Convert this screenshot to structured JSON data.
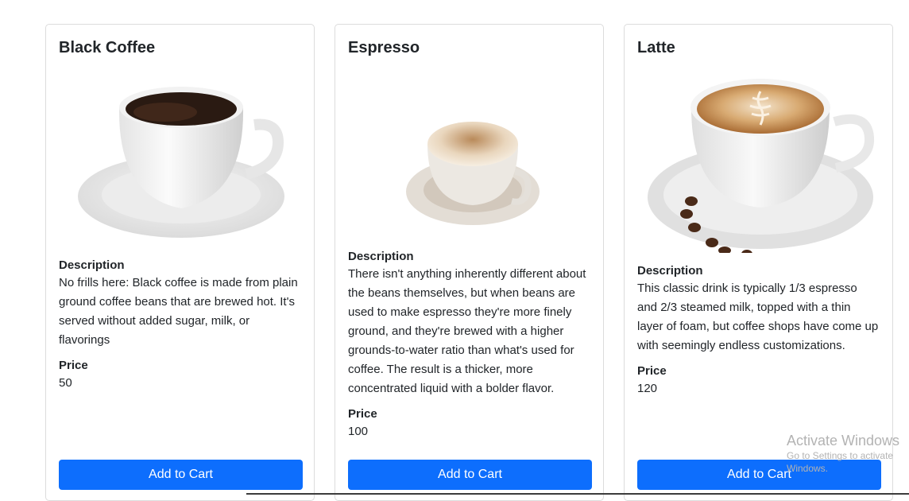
{
  "products": [
    {
      "name": "Black Coffee",
      "description_label": "Description",
      "description": "No frills here: Black coffee is made from plain ground coffee beans that are brewed hot. It's served without added sugar, milk, or flavorings",
      "price_label": "Price",
      "price": "50",
      "button_label": "Add to Cart"
    },
    {
      "name": "Espresso",
      "description_label": "Description",
      "description": "There isn't anything inherently different about the beans themselves, but when beans are used to make espresso they're more finely ground, and they're brewed with a higher grounds-to-water ratio than what's used for coffee. The result is a thicker, more concentrated liquid with a bolder flavor.",
      "price_label": "Price",
      "price": "100",
      "button_label": "Add to Cart"
    },
    {
      "name": "Latte",
      "description_label": "Description",
      "description": "This classic drink is typically 1/3 espresso and 2/3 steamed milk, topped with a thin layer of foam, but coffee shops have come up with seemingly endless customizations.",
      "price_label": "Price",
      "price": "120",
      "button_label": "Add to Cart"
    }
  ],
  "watermark": {
    "line1": "Activate Windows",
    "line2": "Go to Settings to activate Windows."
  },
  "colors": {
    "button": "#0d6efd",
    "card_border": "#dcdcdc"
  }
}
